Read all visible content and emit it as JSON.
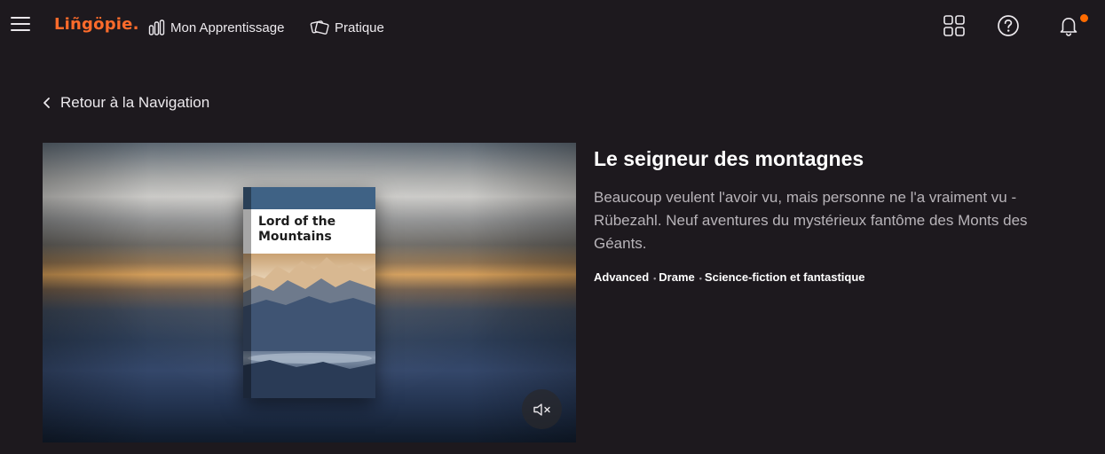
{
  "header": {
    "logo": "Liñgöpie.",
    "nav": [
      {
        "label": "Mon Apprentissage",
        "icon": "bar-chart-icon"
      },
      {
        "label": "Pratique",
        "icon": "cards-icon"
      }
    ],
    "right_icons": [
      "grid-icon",
      "help-icon",
      "bell-icon"
    ],
    "accent_color": "#ff6b2b",
    "notification_color": "#ff6b00"
  },
  "back_link": {
    "label": "Retour à la Navigation",
    "icon": "chevron-left-icon"
  },
  "hero": {
    "book_title": "Lord of the Mountains",
    "mute_icon": "volume-mute-icon"
  },
  "details": {
    "title": "Le seigneur des montagnes",
    "description": "Beaucoup veulent l'avoir vu, mais personne ne l'a vraiment vu - Rübezahl. Neuf aventures du mystérieux fantôme des Monts des Géants.",
    "tags": [
      "Advanced",
      "Drame",
      "Science-fiction et fantastique"
    ]
  }
}
